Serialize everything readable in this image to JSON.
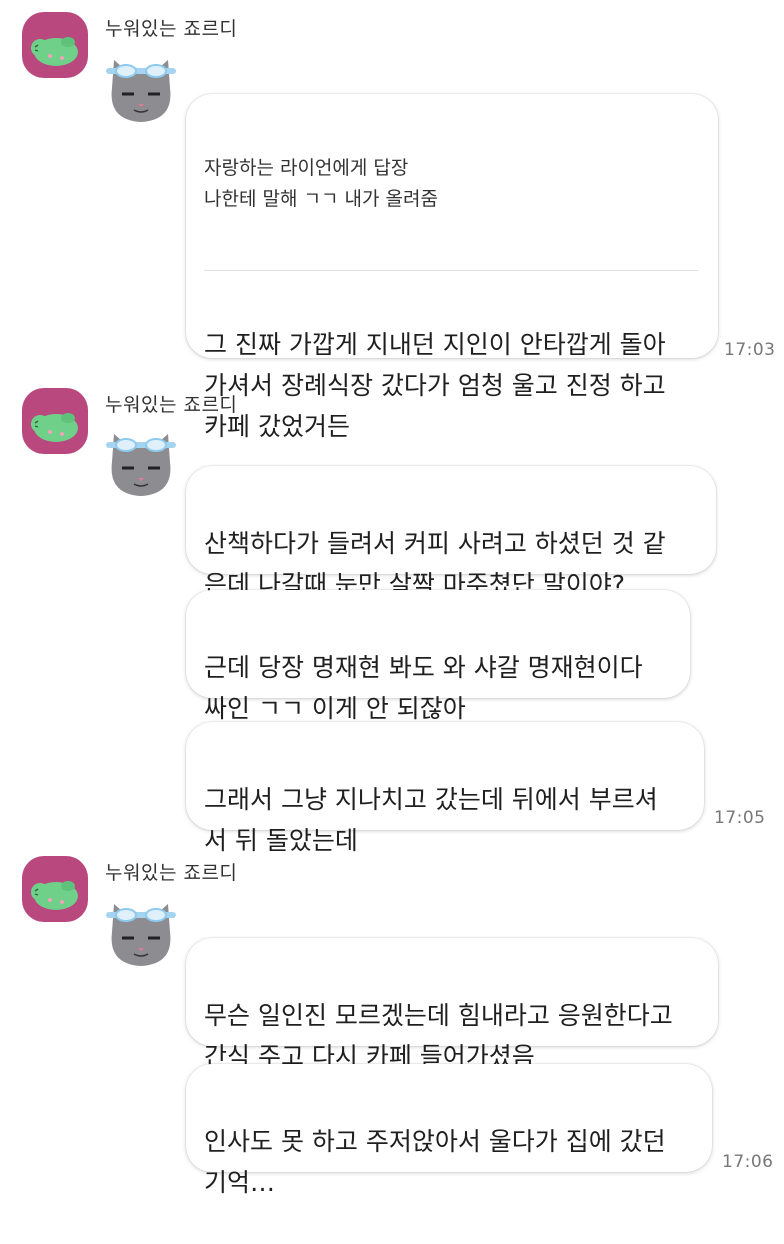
{
  "messages": [
    {
      "sender": "누워있는 죠르디",
      "reply_header": "자랑하는 라이언에게 답장\n나한테 말해 ㄱㄱ 내가 올려줌",
      "bubbles": [
        "그 진짜 가깝게 지내던 지인이 안타깝게 돌아\n가셔서 장례식장 갔다가 엄청 울고 진정 하고\n카페 갔었거든"
      ],
      "time": "17:03"
    },
    {
      "sender": "누워있는 죠르디",
      "bubbles": [
        "산책하다가 들려서 커피 사려고 하셨던 것 같\n은데 나갈때 눈만 살짝 마주쳤단 말이야?",
        "근데 당장 명재현 봐도 와 샤갈 명재현이다\n싸인 ㄱㄱ 이게 안 되잖아",
        "그래서 그냥 지나치고 갔는데 뒤에서 부르셔\n서 뒤 돌았는데"
      ],
      "time": "17:05"
    },
    {
      "sender": "누워있는 죠르디",
      "bubbles": [
        "무슨 일인진 모르겠는데 힘내라고 응원한다고\n간식 주고 다시 카페 들어가셨음",
        "인사도 못 하고 주저앉아서 울다가 집에 갔던\n기억…"
      ],
      "time": "17:06"
    }
  ],
  "icons": {
    "avatar": "jordy-dinosaur-avatar-icon",
    "sticker": "grey-cat-with-goggles-sticker-icon"
  },
  "colors": {
    "avatar_bg": "#b8487e",
    "jordy_green": "#6fd08a",
    "cat_grey": "#8c8c91"
  }
}
